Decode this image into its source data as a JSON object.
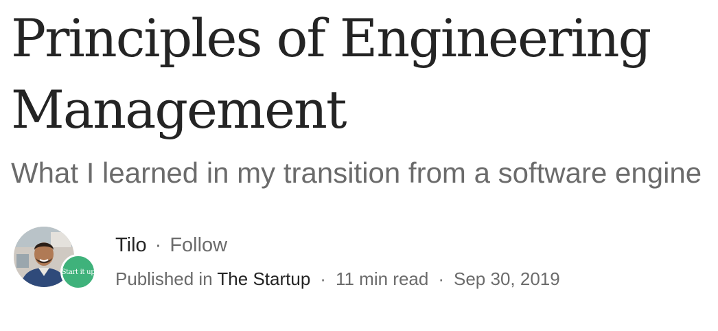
{
  "article": {
    "title": "Principles of Engineering Management",
    "subtitle": "What I learned in my transition from a software engine"
  },
  "author": {
    "name": "Tilo",
    "separator": "·",
    "follow_label": "Follow"
  },
  "publication": {
    "badge_text": "Start it up",
    "prefix": "Published in",
    "name": "The Startup",
    "read_time": "11 min read",
    "date": "Sep 30, 2019",
    "separator": "·"
  },
  "colors": {
    "text_primary": "#242424",
    "text_secondary": "#6b6b6b",
    "publication_badge": "#3fb27b"
  }
}
